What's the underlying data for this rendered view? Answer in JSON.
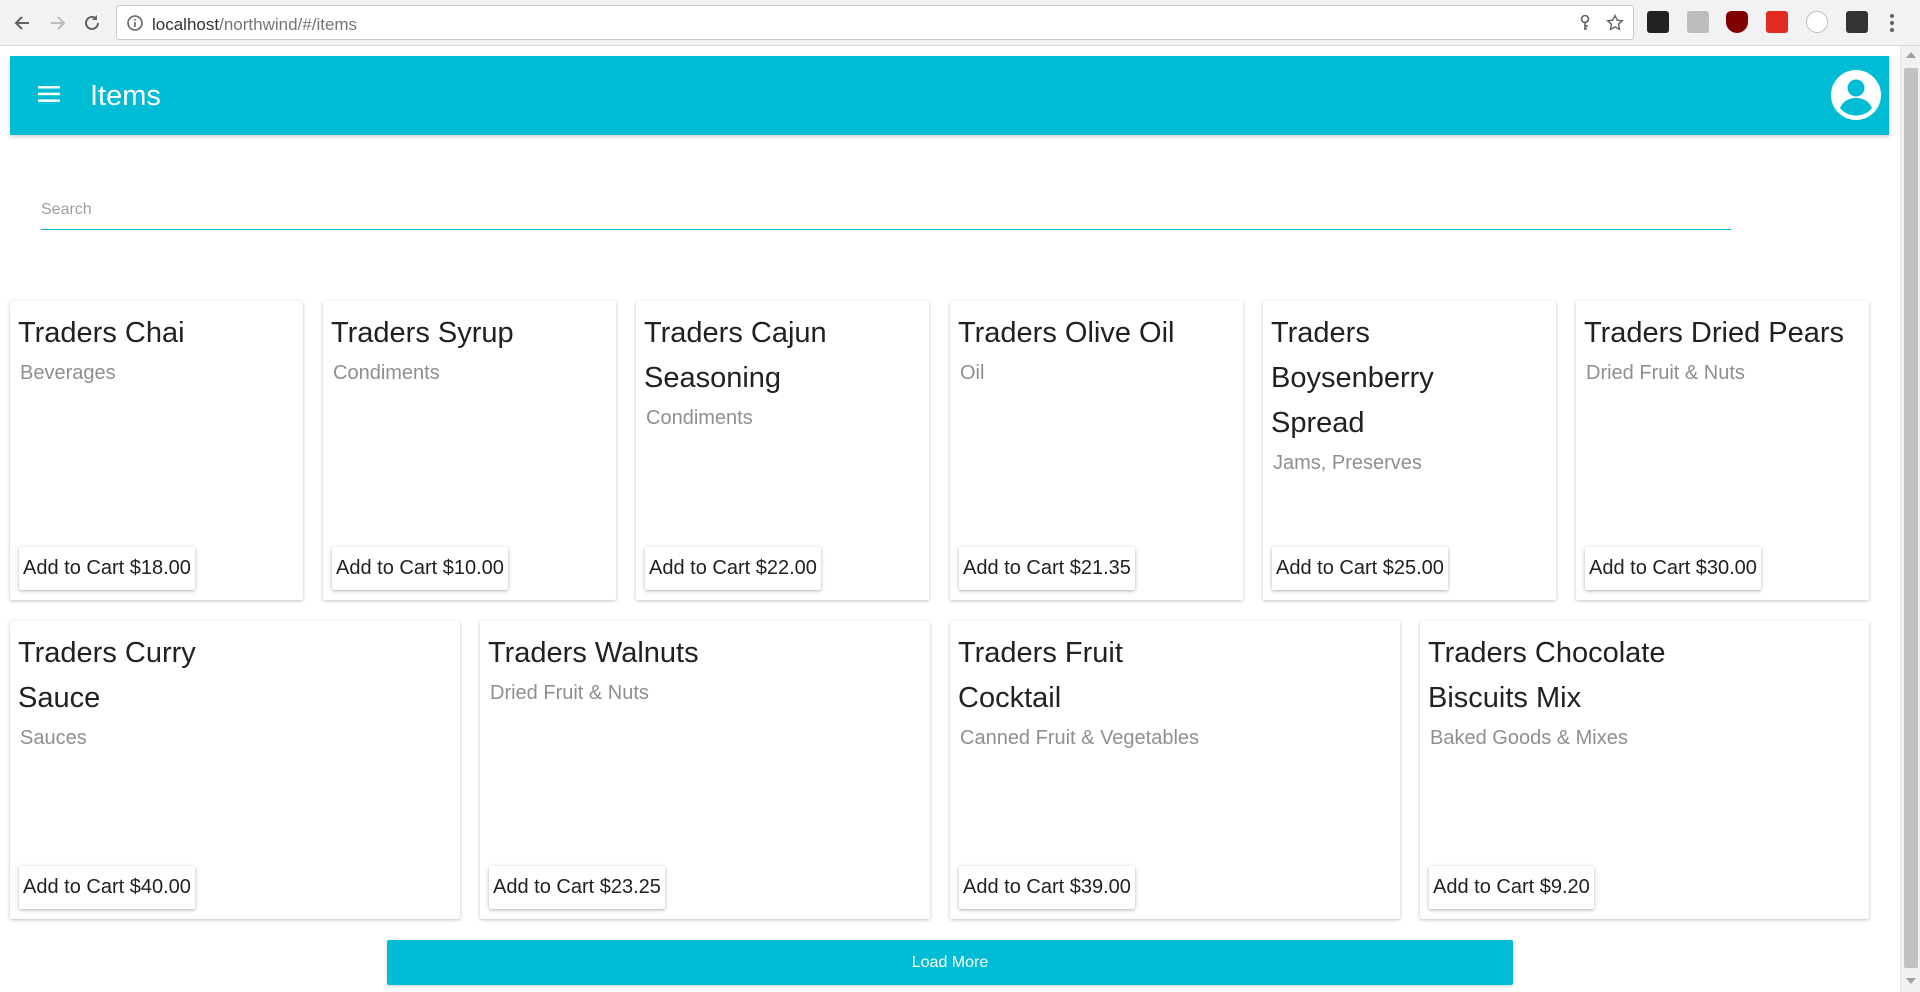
{
  "browser": {
    "url_host": "localhost",
    "url_path": "/northwind/#/items"
  },
  "colors": {
    "accent": "#00bcd4"
  },
  "header": {
    "title": "Items"
  },
  "search": {
    "placeholder": "Search",
    "value": ""
  },
  "items": [
    {
      "title_lines": [
        "Traders Chai"
      ],
      "category": "Beverages",
      "button": "Add to Cart $18.00"
    },
    {
      "title_lines": [
        "Traders Syrup"
      ],
      "category": "Condiments",
      "button": "Add to Cart $10.00"
    },
    {
      "title_lines": [
        "Traders Cajun",
        "Seasoning"
      ],
      "category": "Condiments",
      "button": "Add to Cart $22.00"
    },
    {
      "title_lines": [
        "Traders Olive Oil"
      ],
      "category": "Oil",
      "button": "Add to Cart $21.35"
    },
    {
      "title_lines": [
        "Traders",
        "Boysenberry",
        "Spread"
      ],
      "category": "Jams, Preserves",
      "button": "Add to Cart $25.00"
    },
    {
      "title_lines": [
        "Traders Dried Pears"
      ],
      "category": "Dried Fruit & Nuts",
      "button": "Add to Cart $30.00"
    },
    {
      "title_lines": [
        "Traders Curry",
        "Sauce"
      ],
      "category": "Sauces",
      "button": "Add to Cart $40.00"
    },
    {
      "title_lines": [
        "Traders Walnuts"
      ],
      "category": "Dried Fruit & Nuts",
      "button": "Add to Cart $23.25"
    },
    {
      "title_lines": [
        "Traders Fruit",
        "Cocktail"
      ],
      "category": "Canned Fruit & Vegetables",
      "button": "Add to Cart $39.00"
    },
    {
      "title_lines": [
        "Traders Chocolate",
        "Biscuits Mix"
      ],
      "category": "Baked Goods & Mixes",
      "button": "Add to Cart $9.20"
    }
  ],
  "load_more": {
    "label": "Load More"
  }
}
